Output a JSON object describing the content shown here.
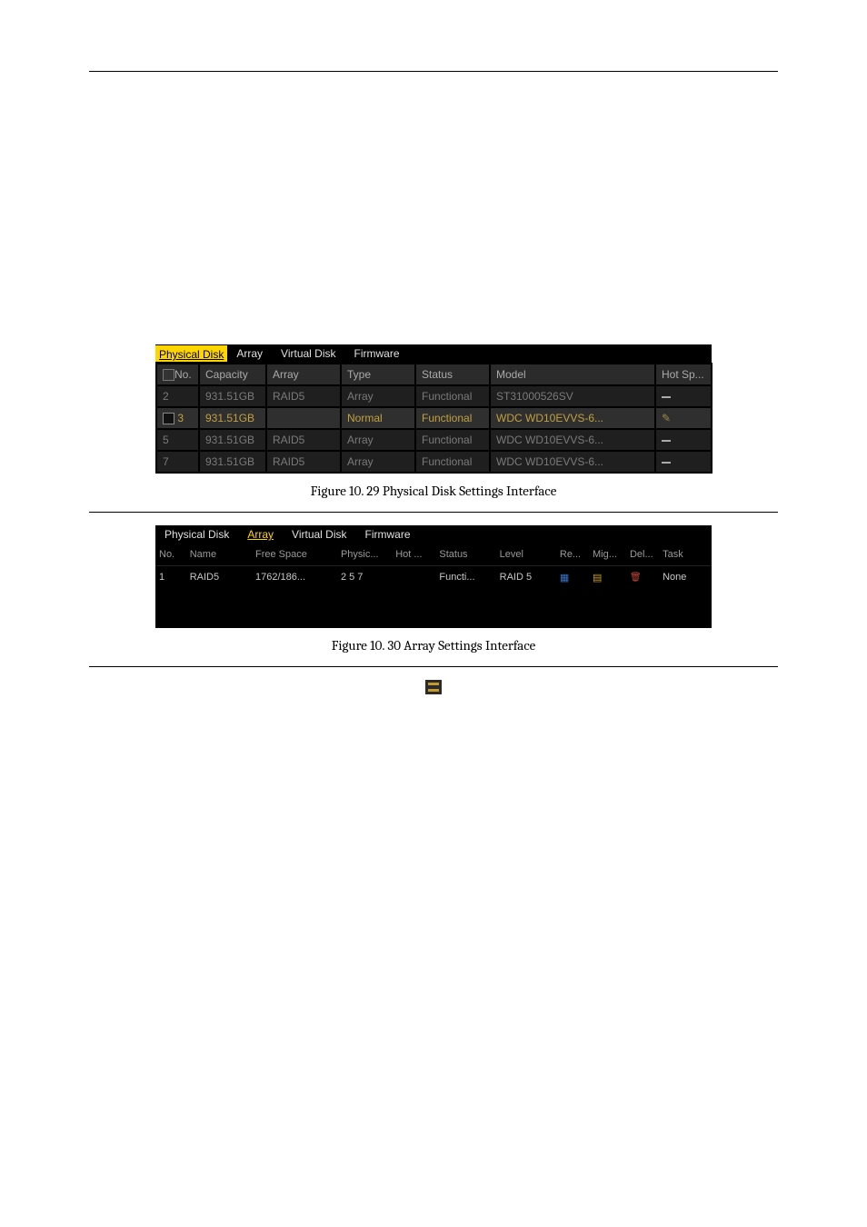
{
  "tabs": {
    "physical_disk": "Physical Disk",
    "array": "Array",
    "virtual_disk": "Virtual Disk",
    "firmware": "Firmware"
  },
  "physical_disk": {
    "headers": {
      "no": "No.",
      "capacity": "Capacity",
      "array": "Array",
      "type": "Type",
      "status": "Status",
      "model": "Model",
      "hot_sp": "Hot Sp..."
    },
    "rows": [
      {
        "no": "2",
        "capacity": "931.51GB",
        "array": "RAID5",
        "type": "Array",
        "status": "Functional",
        "model": "ST31000526SV",
        "hot": "-",
        "selected": false
      },
      {
        "no": "3",
        "capacity": "931.51GB",
        "array": "",
        "type": "Normal",
        "status": "Functional",
        "model": "WDC WD10EVVS-6...",
        "hot": "edit",
        "selected": true
      },
      {
        "no": "5",
        "capacity": "931.51GB",
        "array": "RAID5",
        "type": "Array",
        "status": "Functional",
        "model": "WDC WD10EVVS-6...",
        "hot": "-",
        "selected": false
      },
      {
        "no": "7",
        "capacity": "931.51GB",
        "array": "RAID5",
        "type": "Array",
        "status": "Functional",
        "model": "WDC WD10EVVS-6...",
        "hot": "-",
        "selected": false
      }
    ]
  },
  "fig1_caption": "Figure 10. 29 Physical Disk Settings Interface",
  "array": {
    "headers": {
      "no": "No.",
      "name": "Name",
      "free_space": "Free Space",
      "physic": "Physic...",
      "hot": "Hot ...",
      "status": "Status",
      "level": "Level",
      "re": "Re...",
      "mig": "Mig...",
      "del": "Del...",
      "task": "Task"
    },
    "rows": [
      {
        "no": "1",
        "name": "RAID5",
        "free_space": "1762/186...",
        "physic": "2 5 7",
        "hot": "",
        "status": "Functi...",
        "level": "RAID 5",
        "task": "None"
      }
    ]
  },
  "fig2_caption": "Figure 10. 30 Array Settings Interface"
}
